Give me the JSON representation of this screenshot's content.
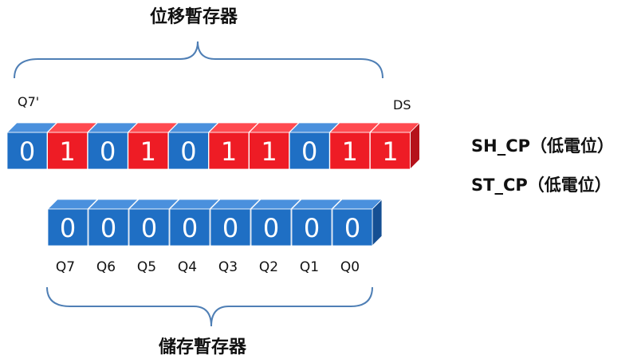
{
  "shift_register": {
    "title": "位移暫存器",
    "overflow_label": "Q7'",
    "input_label": "DS",
    "bits": [
      "0",
      "1",
      "0",
      "1",
      "0",
      "1",
      "1",
      "0",
      "1",
      "1"
    ],
    "colors": [
      "blue",
      "red",
      "blue",
      "red",
      "blue",
      "red",
      "red",
      "blue",
      "red",
      "red"
    ]
  },
  "storage_register": {
    "title": "儲存暫存器",
    "bits": [
      "0",
      "0",
      "0",
      "0",
      "0",
      "0",
      "0",
      "0"
    ],
    "labels": [
      "Q7",
      "Q6",
      "Q5",
      "Q4",
      "Q3",
      "Q2",
      "Q1",
      "Q0"
    ]
  },
  "clock_states": {
    "sh_cp": "SH_CP（低電位）",
    "st_cp": "ST_CP（低電位）"
  },
  "palette": {
    "blue_front": "#1f6fc4",
    "blue_top": "#4a90dd",
    "blue_side": "#154f93",
    "red_front": "#ee1c25",
    "red_top": "#ff4a50",
    "red_side": "#b5121a",
    "brace": "#4f7fb5"
  }
}
